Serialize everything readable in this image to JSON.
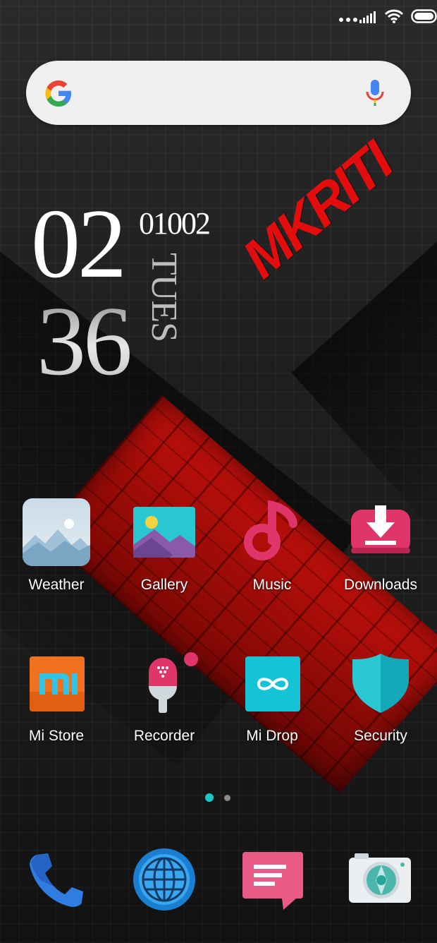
{
  "status_bar": {
    "icons": [
      "more-dots-icon",
      "signal-icon",
      "wifi-icon",
      "battery-icon"
    ]
  },
  "search_bar": {
    "icons": [
      "google-icon",
      "mic-icon"
    ]
  },
  "clock_widget": {
    "hour": "02",
    "minute": "36",
    "date": "01002",
    "day": "TUES"
  },
  "wallpaper": {
    "logo_text": "MKRITI",
    "accent_color": "#e30d0d"
  },
  "apps": [
    {
      "label": "Weather",
      "icon": "weather-icon"
    },
    {
      "label": "Gallery",
      "icon": "gallery-icon"
    },
    {
      "label": "Music",
      "icon": "music-icon"
    },
    {
      "label": "Downloads",
      "icon": "downloads-icon"
    },
    {
      "label": "Mi Store",
      "icon": "mi-store-icon"
    },
    {
      "label": "Recorder",
      "icon": "recorder-icon"
    },
    {
      "label": "Mi Drop",
      "icon": "mi-drop-icon"
    },
    {
      "label": "Security",
      "icon": "security-icon"
    }
  ],
  "page_indicator": {
    "pages": 2,
    "current": 1,
    "active_color": "#1ac9c6"
  },
  "dock": [
    {
      "icon": "phone-icon"
    },
    {
      "icon": "browser-icon"
    },
    {
      "icon": "messaging-icon"
    },
    {
      "icon": "camera-icon"
    }
  ]
}
